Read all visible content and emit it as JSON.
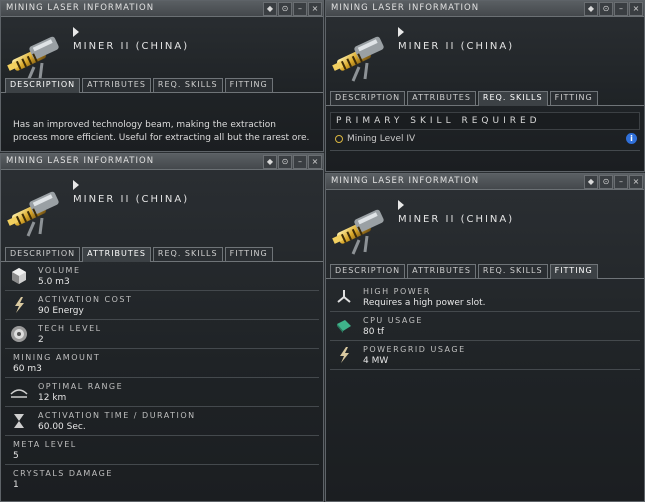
{
  "windows": {
    "title": "MINING LASER INFORMATION",
    "item_name": "MINER II (CHINA)",
    "buttons": [
      "◆",
      "⊙",
      "–",
      "×"
    ]
  },
  "tabs": [
    "DESCRIPTION",
    "ATTRIBUTES",
    "REQ. SKILLS",
    "FITTING"
  ],
  "description": {
    "text": "Has an improved technology beam, making the extraction process more efficient. Useful for extracting all but the rarest ore."
  },
  "req_skills": {
    "header": "PRIMARY SKILL REQUIRED",
    "skill": "Mining Level IV",
    "info_icon": "i"
  },
  "attributes": [
    {
      "label": "VOLUME",
      "value": "5.0 m3",
      "icon": "cube-icon"
    },
    {
      "label": "ACTIVATION COST",
      "value": "90 Energy",
      "icon": "capacitor-icon"
    },
    {
      "label": "TECH LEVEL",
      "value": "2",
      "icon": "tech-icon"
    },
    {
      "label": "MINING AMOUNT",
      "value": "60 m3",
      "icon": ""
    },
    {
      "label": "OPTIMAL RANGE",
      "value": "12 km",
      "icon": "range-icon"
    },
    {
      "label": "ACTIVATION TIME / DURATION",
      "value": "60.00 Sec.",
      "icon": "hourglass-icon"
    },
    {
      "label": "META LEVEL",
      "value": "5",
      "icon": ""
    },
    {
      "label": "CRYSTALS DAMAGE",
      "value": "1",
      "icon": ""
    }
  ],
  "fitting": [
    {
      "label": "HIGH POWER",
      "value": "Requires a high power slot.",
      "icon": "high-slot-icon"
    },
    {
      "label": "CPU USAGE",
      "value": "80 tf",
      "icon": "cpu-icon"
    },
    {
      "label": "POWERGRID USAGE",
      "value": "4 MW",
      "icon": "powergrid-icon"
    }
  ]
}
